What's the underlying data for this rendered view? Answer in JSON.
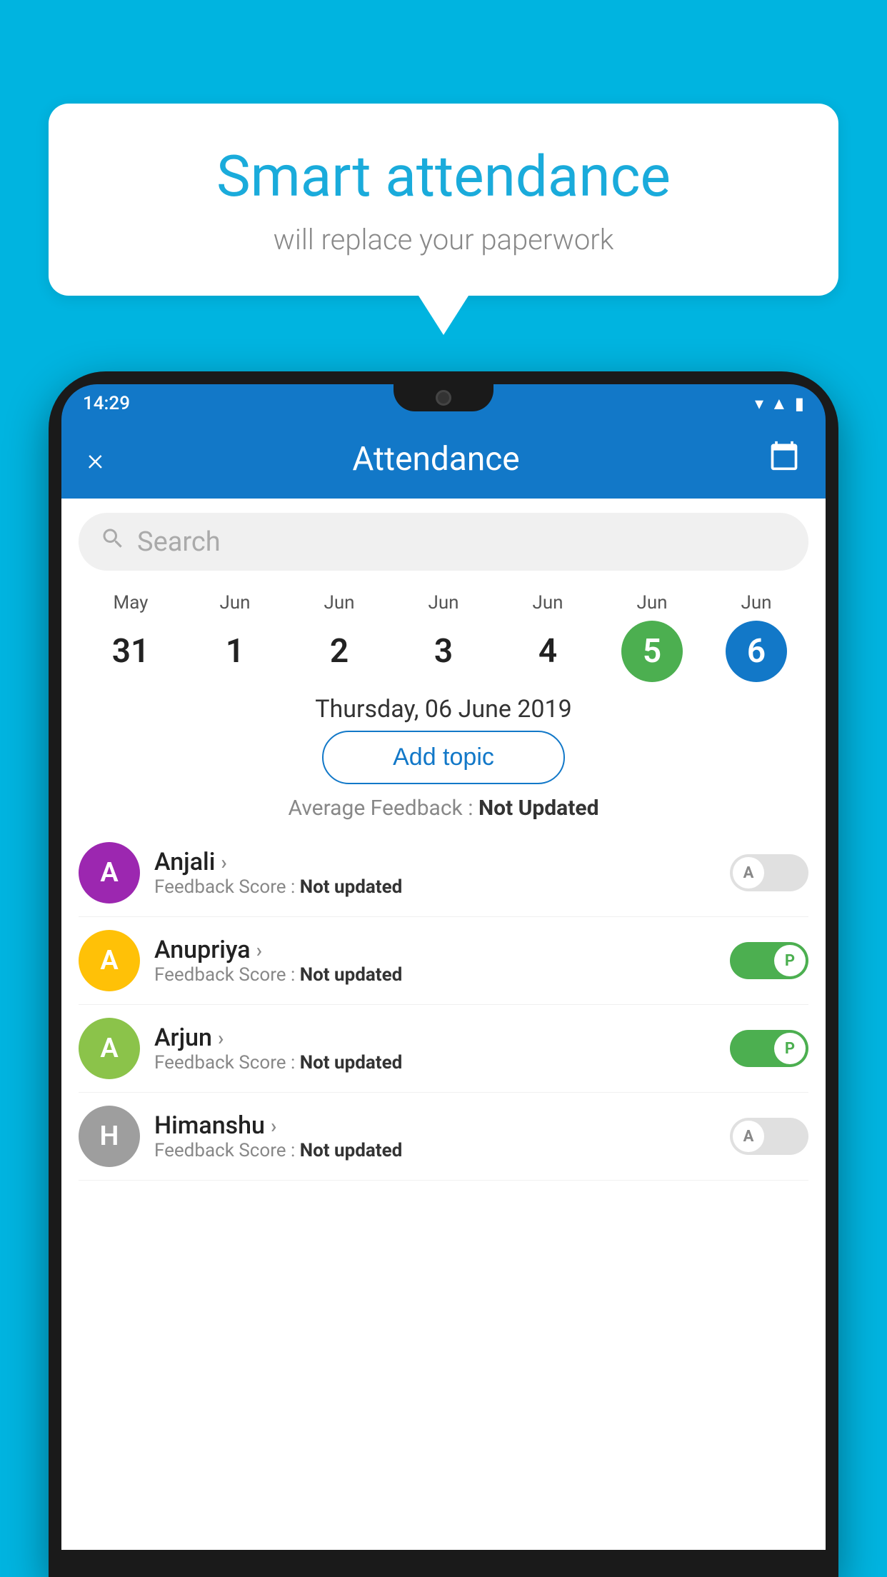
{
  "background_color": "#00b4e0",
  "speech_bubble": {
    "title": "Smart attendance",
    "subtitle": "will replace your paperwork"
  },
  "phone": {
    "status_bar": {
      "time": "14:29",
      "icons": [
        "wifi",
        "signal",
        "battery"
      ]
    },
    "header": {
      "close_label": "×",
      "title": "Attendance",
      "calendar_icon": "📅"
    },
    "search": {
      "placeholder": "Search"
    },
    "dates": [
      {
        "month": "May",
        "day": "31",
        "state": "normal"
      },
      {
        "month": "Jun",
        "day": "1",
        "state": "normal"
      },
      {
        "month": "Jun",
        "day": "2",
        "state": "normal"
      },
      {
        "month": "Jun",
        "day": "3",
        "state": "normal"
      },
      {
        "month": "Jun",
        "day": "4",
        "state": "normal"
      },
      {
        "month": "Jun",
        "day": "5",
        "state": "green"
      },
      {
        "month": "Jun",
        "day": "6",
        "state": "blue"
      }
    ],
    "selected_date_label": "Thursday, 06 June 2019",
    "add_topic_label": "Add topic",
    "avg_feedback_label": "Average Feedback :",
    "avg_feedback_value": "Not Updated",
    "students": [
      {
        "name": "Anjali",
        "avatar_letter": "A",
        "avatar_color": "#9c27b0",
        "feedback_label": "Feedback Score :",
        "feedback_value": "Not updated",
        "attendance": "A",
        "attendance_on": false
      },
      {
        "name": "Anupriya",
        "avatar_letter": "A",
        "avatar_color": "#ffc107",
        "feedback_label": "Feedback Score :",
        "feedback_value": "Not updated",
        "attendance": "P",
        "attendance_on": true
      },
      {
        "name": "Arjun",
        "avatar_letter": "A",
        "avatar_color": "#8bc34a",
        "feedback_label": "Feedback Score :",
        "feedback_value": "Not updated",
        "attendance": "P",
        "attendance_on": true
      },
      {
        "name": "Himanshu",
        "avatar_letter": "H",
        "avatar_color": "#9e9e9e",
        "feedback_label": "Feedback Score :",
        "feedback_value": "Not updated",
        "attendance": "A",
        "attendance_on": false
      }
    ]
  }
}
